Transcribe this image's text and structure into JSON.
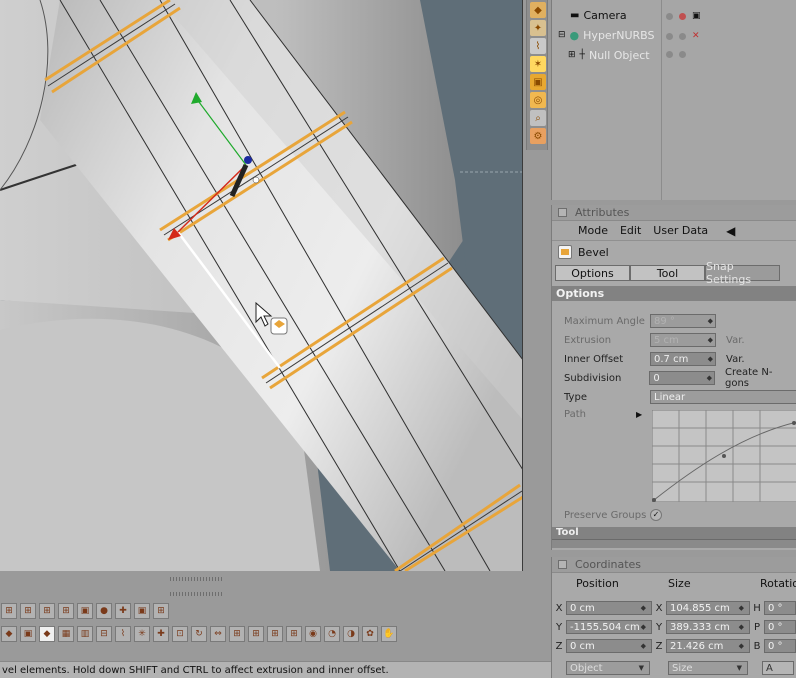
{
  "object_manager": {
    "objects": [
      {
        "label": "Camera",
        "icon": "camera-icon"
      },
      {
        "label": "HyperNURBS",
        "icon": "hypernurbs-icon"
      },
      {
        "label": "Null Object",
        "icon": "null-object-icon"
      }
    ]
  },
  "attributes": {
    "title": "Attributes",
    "menu": [
      "Mode",
      "Edit",
      "User Data"
    ],
    "tool_name": "Bevel",
    "tabs": [
      "Options",
      "Tool",
      "Snap Settings"
    ],
    "section": "Options",
    "fields": {
      "max_angle": {
        "label": "Maximum Angle",
        "value": "89 °"
      },
      "extrusion": {
        "label": "Extrusion",
        "value": "5 cm"
      },
      "inner_offset": {
        "label": "Inner Offset",
        "value": "0.7 cm"
      },
      "subdivision": {
        "label": "Subdivision",
        "value": "0"
      },
      "type": {
        "label": "Type",
        "value": "Linear"
      },
      "path": {
        "label": "Path"
      },
      "preserve_groups": {
        "label": "Preserve Groups"
      }
    },
    "right_labels": [
      "Var.",
      "Var.",
      "Create N-gons"
    ],
    "next_section": "Tool"
  },
  "coordinates": {
    "title": "Coordinates",
    "headers": [
      "Position",
      "Size",
      "Rotation"
    ],
    "rows": [
      {
        "axis": "X",
        "pos": "0 cm",
        "size_axis": "X",
        "size": "104.855 cm",
        "rot_axis": "H",
        "rot": "0 °"
      },
      {
        "axis": "Y",
        "pos": "-1155.504 cm",
        "size_axis": "Y",
        "size": "389.333 cm",
        "rot_axis": "P",
        "rot": "0 °"
      },
      {
        "axis": "Z",
        "pos": "0 cm",
        "size_axis": "Z",
        "size": "21.426 cm",
        "rot_axis": "B",
        "rot": "0 °"
      }
    ],
    "mode_select": "Object",
    "size_select": "Size",
    "apply_label": "A"
  },
  "status_text": "vel elements. Hold down SHIFT and CTRL to affect extrusion and inner offset.",
  "colors": {
    "loop_orange": "#e8a53a",
    "selected_edge": "#ffffff",
    "axis_green": "#1faa2c",
    "axis_red": "#d42a1a",
    "axis_blue": "#1c2aa0"
  }
}
